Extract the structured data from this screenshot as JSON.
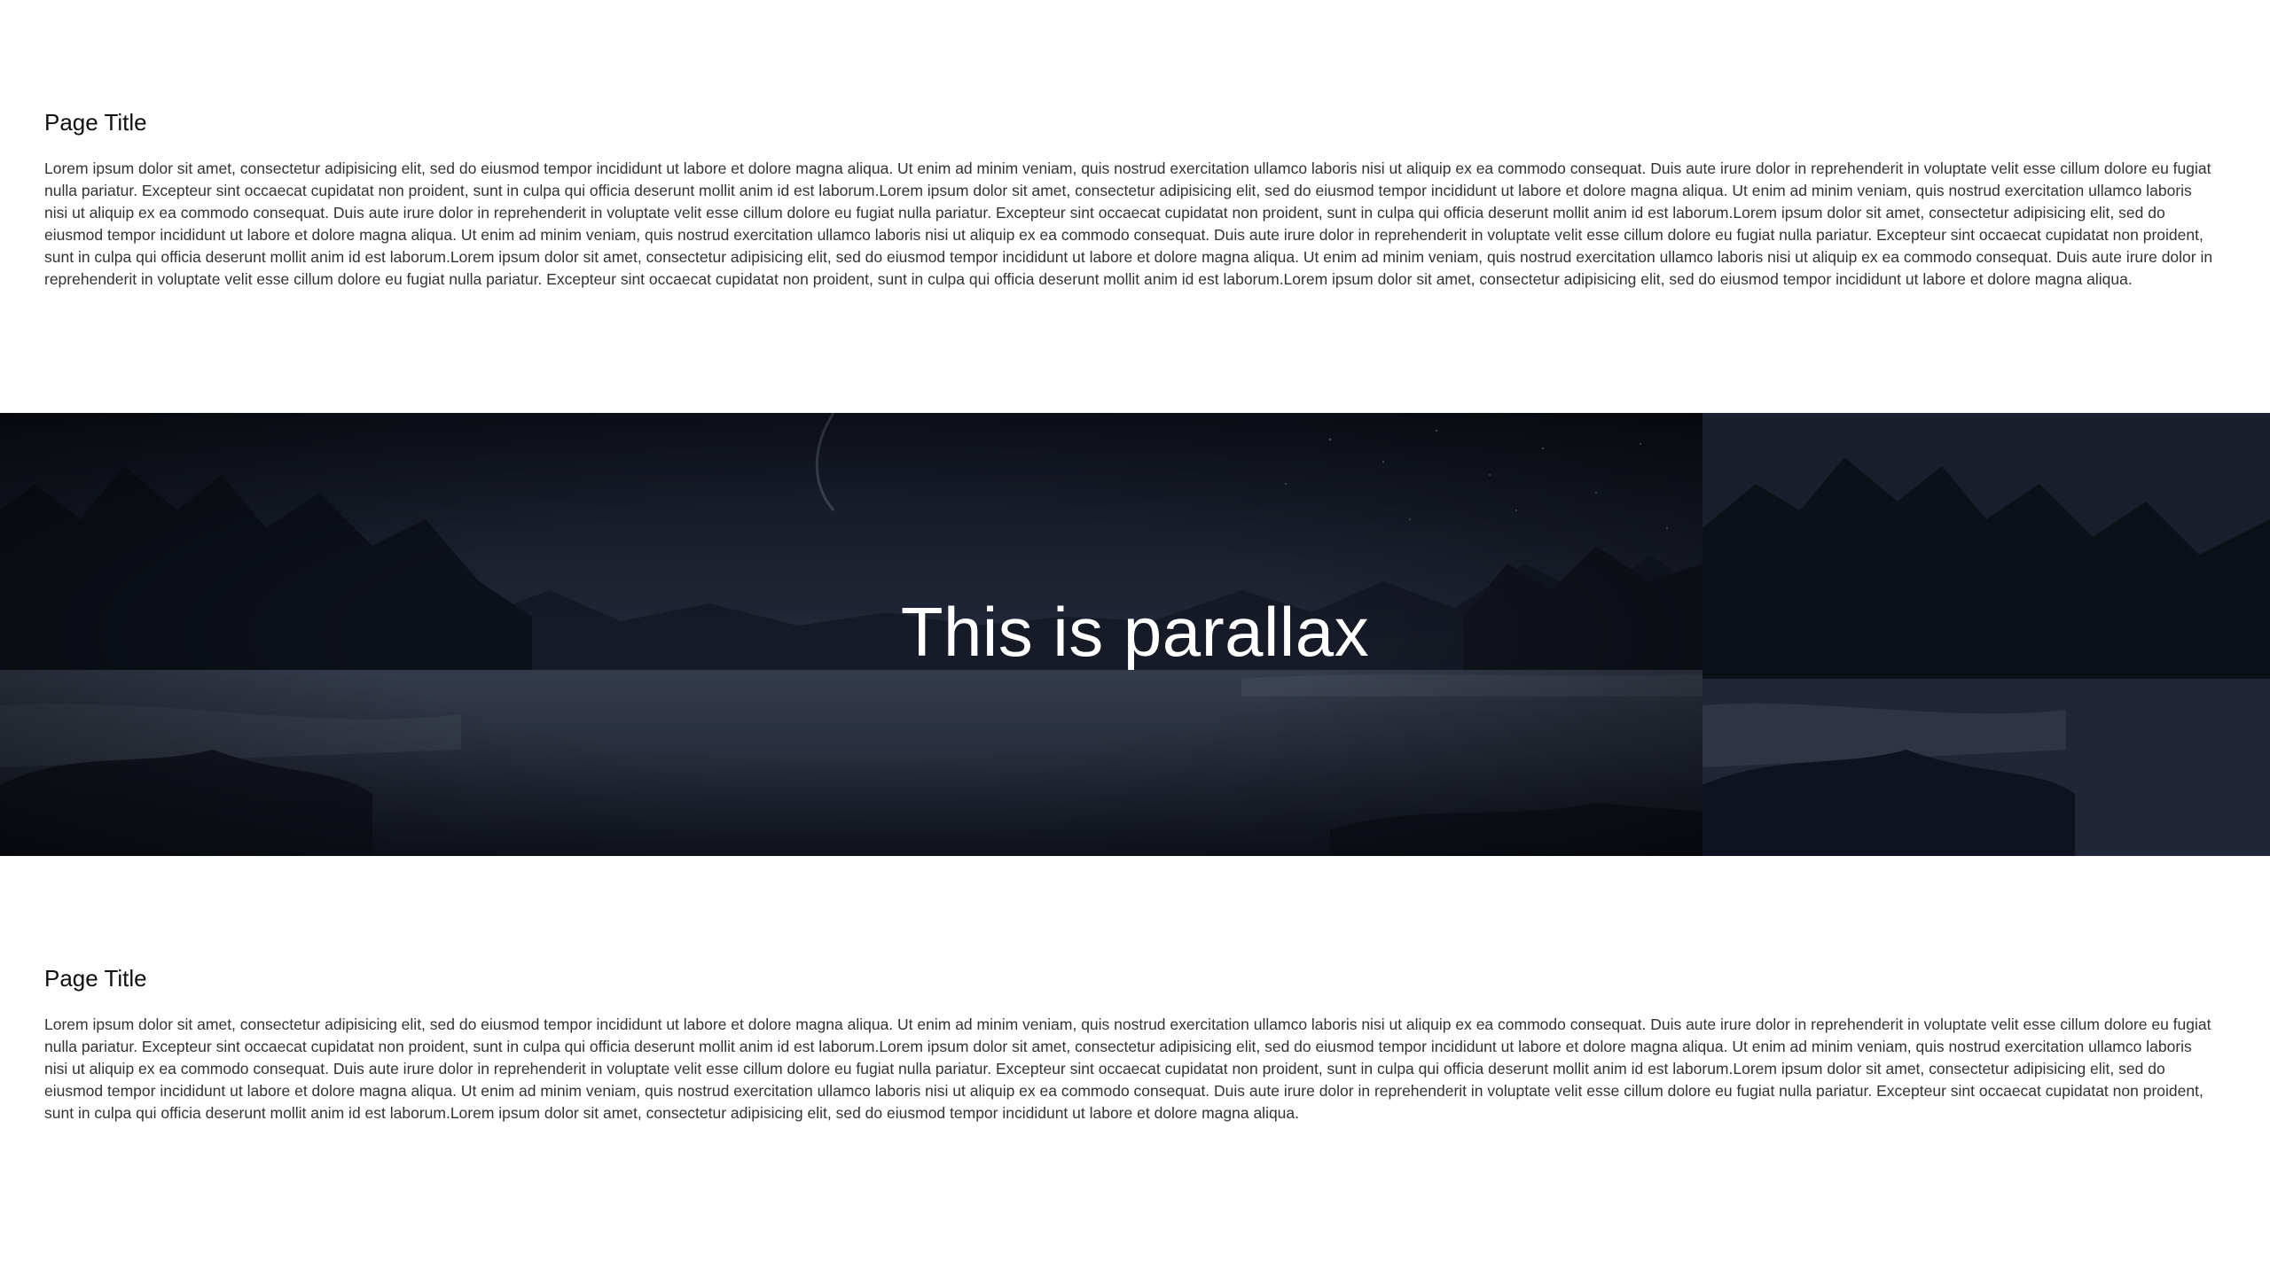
{
  "sections": [
    {
      "title": "Page Title",
      "body": "Lorem ipsum dolor sit amet, consectetur adipisicing elit, sed do eiusmod tempor incididunt ut labore et dolore magna aliqua. Ut enim ad minim veniam, quis nostrud exercitation ullamco laboris nisi ut aliquip ex ea commodo consequat. Duis aute irure dolor in reprehenderit in voluptate velit esse cillum dolore eu fugiat nulla pariatur. Excepteur sint occaecat cupidatat non proident, sunt in culpa qui officia deserunt mollit anim id est laborum.Lorem ipsum dolor sit amet, consectetur adipisicing elit, sed do eiusmod tempor incididunt ut labore et dolore magna aliqua. Ut enim ad minim veniam, quis nostrud exercitation ullamco laboris nisi ut aliquip ex ea commodo consequat. Duis aute irure dolor in reprehenderit in voluptate velit esse cillum dolore eu fugiat nulla pariatur. Excepteur sint occaecat cupidatat non proident, sunt in culpa qui officia deserunt mollit anim id est laborum.Lorem ipsum dolor sit amet, consectetur adipisicing elit, sed do eiusmod tempor incididunt ut labore et dolore magna aliqua. Ut enim ad minim veniam, quis nostrud exercitation ullamco laboris nisi ut aliquip ex ea commodo consequat. Duis aute irure dolor in reprehenderit in voluptate velit esse cillum dolore eu fugiat nulla pariatur. Excepteur sint occaecat cupidatat non proident, sunt in culpa qui officia deserunt mollit anim id est laborum.Lorem ipsum dolor sit amet, consectetur adipisicing elit, sed do eiusmod tempor incididunt ut labore et dolore magna aliqua. Ut enim ad minim veniam, quis nostrud exercitation ullamco laboris nisi ut aliquip ex ea commodo consequat. Duis aute irure dolor in reprehenderit in voluptate velit esse cillum dolore eu fugiat nulla pariatur. Excepteur sint occaecat cupidatat non proident, sunt in culpa qui officia deserunt mollit anim id est laborum.Lorem ipsum dolor sit amet, consectetur adipisicing elit, sed do eiusmod tempor incididunt ut labore et dolore magna aliqua."
    },
    {
      "title": "Page Title",
      "body": "Lorem ipsum dolor sit amet, consectetur adipisicing elit, sed do eiusmod tempor incididunt ut labore et dolore magna aliqua. Ut enim ad minim veniam, quis nostrud exercitation ullamco laboris nisi ut aliquip ex ea commodo consequat. Duis aute irure dolor in reprehenderit in voluptate velit esse cillum dolore eu fugiat nulla pariatur. Excepteur sint occaecat cupidatat non proident, sunt in culpa qui officia deserunt mollit anim id est laborum.Lorem ipsum dolor sit amet, consectetur adipisicing elit, sed do eiusmod tempor incididunt ut labore et dolore magna aliqua. Ut enim ad minim veniam, quis nostrud exercitation ullamco laboris nisi ut aliquip ex ea commodo consequat. Duis aute irure dolor in reprehenderit in voluptate velit esse cillum dolore eu fugiat nulla pariatur. Excepteur sint occaecat cupidatat non proident, sunt in culpa qui officia deserunt mollit anim id est laborum.Lorem ipsum dolor sit amet, consectetur adipisicing elit, sed do eiusmod tempor incididunt ut labore et dolore magna aliqua. Ut enim ad minim veniam, quis nostrud exercitation ullamco laboris nisi ut aliquip ex ea commodo consequat. Duis aute irure dolor in reprehenderit in voluptate velit esse cillum dolore eu fugiat nulla pariatur. Excepteur sint occaecat cupidatat non proident, sunt in culpa qui officia deserunt mollit anim id est laborum.Lorem ipsum dolor sit amet, consectetur adipisicing elit, sed do eiusmod tempor incididunt ut labore et dolore magna aliqua."
    }
  ],
  "parallax": {
    "heading": "This is parallax",
    "image": "night-lake-landscape",
    "colors": {
      "sky": "#2a3142",
      "sky_dark": "#151a26",
      "water": "#3a4354",
      "trees": "#0e121b",
      "text": "#ffffff"
    }
  },
  "colors": {
    "background": "#ffffff",
    "title": "#111111",
    "text": "#333333"
  }
}
